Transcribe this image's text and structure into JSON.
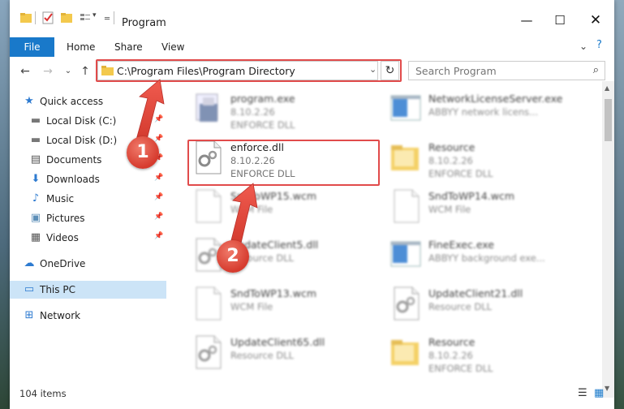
{
  "window": {
    "title": "Program"
  },
  "ribbon": {
    "tabs": [
      "File",
      "Home",
      "Share",
      "View"
    ]
  },
  "address": {
    "path": "C:\\Program Files\\Program Directory"
  },
  "search": {
    "placeholder": "Search Program"
  },
  "nav": {
    "items": [
      {
        "label": "Quick access",
        "icon": "star-icon",
        "pinned": false
      },
      {
        "label": "Local Disk (C:)",
        "icon": "drive-icon",
        "pinned": true
      },
      {
        "label": "Local Disk (D:)",
        "icon": "drive-icon",
        "pinned": true
      },
      {
        "label": "Documents",
        "icon": "documents-icon",
        "pinned": true
      },
      {
        "label": "Downloads",
        "icon": "download-icon",
        "pinned": true
      },
      {
        "label": "Music",
        "icon": "music-icon",
        "pinned": true
      },
      {
        "label": "Pictures",
        "icon": "pictures-icon",
        "pinned": true
      },
      {
        "label": "Videos",
        "icon": "videos-icon",
        "pinned": true
      },
      {
        "label": "OneDrive",
        "icon": "cloud-icon",
        "pinned": false
      },
      {
        "label": "This PC",
        "icon": "computer-icon",
        "pinned": false,
        "selected": true
      },
      {
        "label": "Network",
        "icon": "network-icon",
        "pinned": false
      }
    ]
  },
  "files": {
    "left": [
      {
        "name": "program.exe",
        "line1": "8.10.2.26",
        "line2": "ENFORCE DLL"
      },
      {
        "name": "enforce.dll",
        "line1": "8.10.2.26",
        "line2": "ENFORCE DLL"
      },
      {
        "name": "SndToWP15.wcm",
        "line1": "WCM File",
        "line2": ""
      },
      {
        "name": "UpdateClient5.dll",
        "line1": "Resource DLL",
        "line2": ""
      },
      {
        "name": "SndToWP13.wcm",
        "line1": "WCM File",
        "line2": ""
      },
      {
        "name": "UpdateClient65.dll",
        "line1": "Resource DLL",
        "line2": ""
      }
    ],
    "right": [
      {
        "name": "NetworkLicenseServer.exe",
        "line1": "ABBYY network licens...",
        "line2": ""
      },
      {
        "name": "Resource",
        "line1": "8.10.2.26",
        "line2": "ENFORCE DLL"
      },
      {
        "name": "SndToWP14.wcm",
        "line1": "WCM File",
        "line2": ""
      },
      {
        "name": "FineExec.exe",
        "line1": "ABBYY background exe...",
        "line2": ""
      },
      {
        "name": "UpdateClient21.dll",
        "line1": "Resource DLL",
        "line2": ""
      },
      {
        "name": "Resource",
        "line1": "8.10.2.26",
        "line2": "ENFORCE DLL"
      }
    ]
  },
  "status": {
    "count": "104 items"
  },
  "annotations": {
    "badge1": "1",
    "badge2": "2"
  },
  "colors": {
    "accent": "#1979ca",
    "highlight": "#e14b4b",
    "selected": "#cce4f7"
  }
}
